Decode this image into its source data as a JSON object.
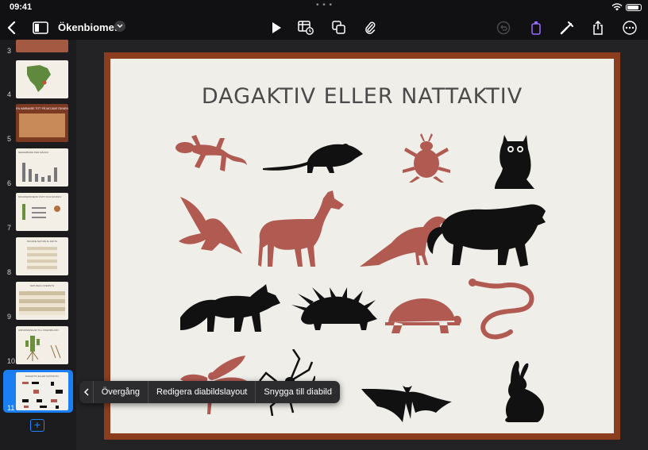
{
  "status": {
    "time": "09:41"
  },
  "toolbar": {
    "document_title": "Ökenbiomet"
  },
  "slides": [
    {
      "number": "3"
    },
    {
      "number": "4"
    },
    {
      "number": "5",
      "text": "EN NÄRMARE TITT PÅ MOJAVE ÖKNEN"
    },
    {
      "number": "6",
      "text": "NEDERBÖRD PER MÅNAD"
    },
    {
      "number": "7",
      "text": "MOJAVEÖKNENS VÄXT OCH DJURLIV"
    },
    {
      "number": "8",
      "text": "MOJAVE NATURLIG FAKTA"
    },
    {
      "number": "9",
      "text": "NATURLIG ÖVERSYN"
    },
    {
      "number": "10",
      "text": "ANPASSNINGAR TILL ÖKENMILJÖN"
    },
    {
      "number": "11",
      "text": "DAGAKTIV ELLER NATTAKTIV"
    }
  ],
  "slide": {
    "title": "DAGAKTIV ELLER NATTAKTIV"
  },
  "context_menu": {
    "items": [
      "Övergång",
      "Redigera diabildslayout",
      "Snygga till diabild"
    ]
  },
  "colors": {
    "accent": "#1a84ff",
    "dusty_red": "#b05a52",
    "silhouette": "#111111",
    "frame": "#8b3d1d"
  }
}
